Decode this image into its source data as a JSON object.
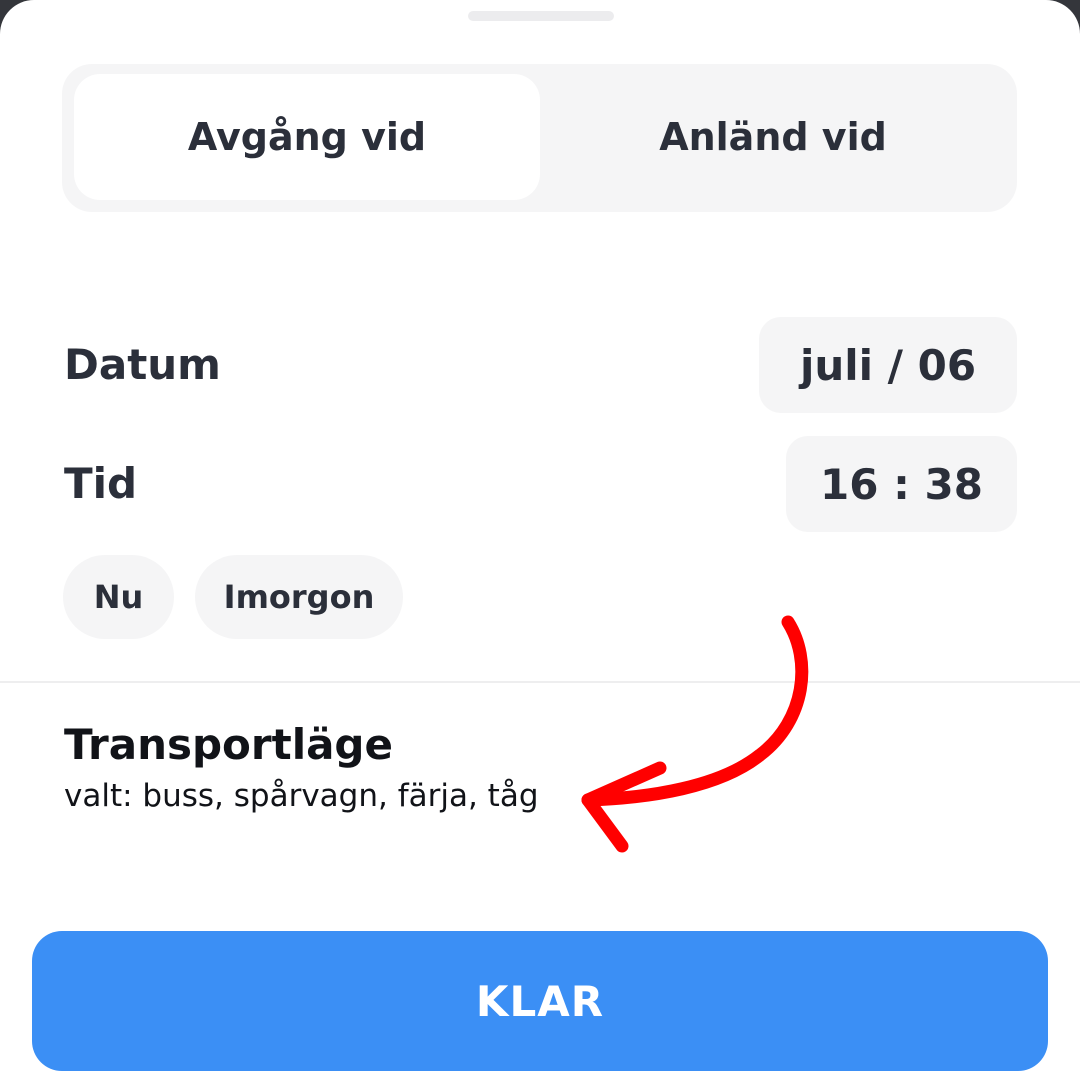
{
  "segmented": {
    "departure_label": "Avgång vid",
    "arrival_label": "Anländ vid",
    "selected": "Avgång vid"
  },
  "date": {
    "label": "Datum",
    "value": "juli / 06"
  },
  "time": {
    "label": "Tid",
    "value": "16 : 38"
  },
  "quick_options": [
    {
      "label": "Nu"
    },
    {
      "label": "Imorgon"
    }
  ],
  "transport": {
    "title": "Transportläge",
    "selected_text": "valt: buss, spårvagn, färja, tåg"
  },
  "done_button": {
    "label": "KLAR"
  },
  "colors": {
    "accent": "#3b8ff5",
    "annotation_arrow": "#ff0000",
    "text": "#2b2f3a",
    "control_bg": "#f5f5f6"
  }
}
